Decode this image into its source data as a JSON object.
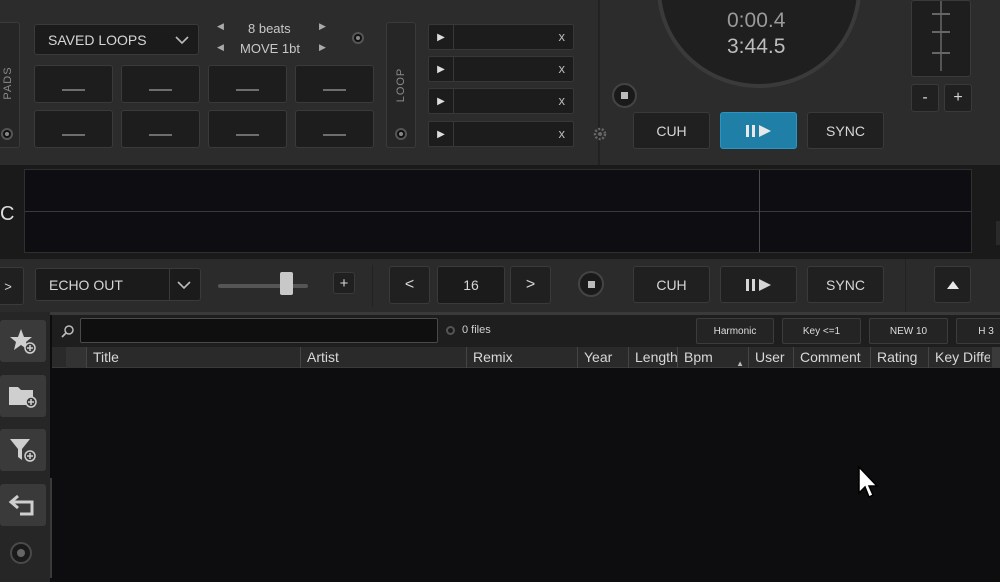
{
  "pads": {
    "side_label": "PADS",
    "mode_select": "SAVED LOOPS",
    "beats_label": "8 beats",
    "move_label": "MOVE 1bt"
  },
  "loop": {
    "side_label": "LOOP",
    "slot_close": "x"
  },
  "clock": {
    "elapsed": "0:00.4",
    "remaining": "3:44.5"
  },
  "deck_top_buttons": {
    "cue": "CUH",
    "sync": "SYNC"
  },
  "pitch": {
    "minus": "-",
    "plus": "+"
  },
  "waveform": {
    "left_letter": "C"
  },
  "transport": {
    "left_arrow": ">",
    "effect_select": "ECHO OUT",
    "add_effect": "+",
    "loop_prev": "<",
    "loop_value": "16",
    "loop_next": ">",
    "cue": "CUH",
    "sync": "SYNC"
  },
  "browser": {
    "search_placeholder": "",
    "file_count": "0 files",
    "filters": [
      "Harmonic",
      "Key <=1",
      "NEW 10",
      "H 3"
    ],
    "columns": [
      "Title",
      "Artist",
      "Remix",
      "Year",
      "Length",
      "Bpm",
      "User",
      "Comment",
      "Rating",
      "Key Diffe"
    ],
    "folders_tab": "folders"
  },
  "colors": {
    "accent_play": "#1f7fa6",
    "background": "#0d0d10",
    "panel": "#2c2c2c"
  }
}
